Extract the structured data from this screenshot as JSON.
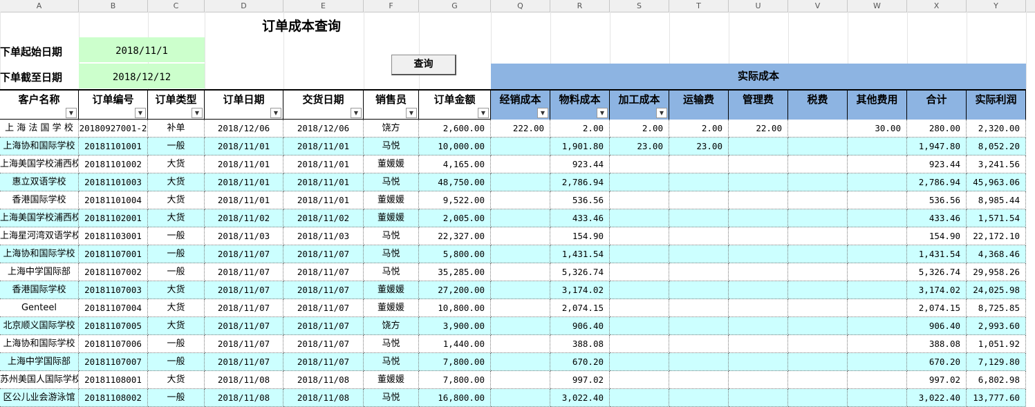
{
  "column_letters": [
    "A",
    "B",
    "C",
    "D",
    "E",
    "F",
    "G",
    "Q",
    "R",
    "S",
    "T",
    "U",
    "V",
    "W",
    "X",
    "Y"
  ],
  "title": "订单成本查询",
  "start_label": "下单起始日期",
  "start_value": "2018/11/1",
  "end_label": "下单截至日期",
  "end_value": "2018/12/12",
  "query_button": "查询",
  "band_label": "实际成本",
  "headers": [
    "客户名称",
    "订单编号",
    "订单类型",
    "订单日期",
    "交货日期",
    "销售员",
    "订单金额",
    "经销成本",
    "物料成本",
    "加工成本",
    "运输费",
    "管理费",
    "税费",
    "其他费用",
    "合计",
    "实际利润"
  ],
  "rows": [
    [
      "上 海 法 国 学 校",
      "20180927001-2",
      "补单",
      "2018/12/06",
      "2018/12/06",
      "饶方",
      "2,600.00",
      "222.00",
      "2.00",
      "2.00",
      "2.00",
      "22.00",
      "",
      "30.00",
      "280.00",
      "2,320.00"
    ],
    [
      "上海协和国际学校",
      "20181101001",
      "一般",
      "2018/11/01",
      "2018/11/01",
      "马悦",
      "10,000.00",
      "",
      "1,901.80",
      "23.00",
      "23.00",
      "",
      "",
      "",
      "1,947.80",
      "8,052.20"
    ],
    [
      "上海美国学校浦西校",
      "20181101002",
      "大货",
      "2018/11/01",
      "2018/11/01",
      "董媛媛",
      "4,165.00",
      "",
      "923.44",
      "",
      "",
      "",
      "",
      "",
      "923.44",
      "3,241.56"
    ],
    [
      "惠立双语学校",
      "20181101003",
      "大货",
      "2018/11/01",
      "2018/11/01",
      "马悦",
      "48,750.00",
      "",
      "2,786.94",
      "",
      "",
      "",
      "",
      "",
      "2,786.94",
      "45,963.06"
    ],
    [
      "香港国际学校",
      "20181101004",
      "大货",
      "2018/11/01",
      "2018/11/01",
      "董媛媛",
      "9,522.00",
      "",
      "536.56",
      "",
      "",
      "",
      "",
      "",
      "536.56",
      "8,985.44"
    ],
    [
      "上海美国学校浦西校",
      "20181102001",
      "大货",
      "2018/11/02",
      "2018/11/02",
      "董媛媛",
      "2,005.00",
      "",
      "433.46",
      "",
      "",
      "",
      "",
      "",
      "433.46",
      "1,571.54"
    ],
    [
      "上海星河湾双语学校",
      "20181103001",
      "一般",
      "2018/11/03",
      "2018/11/03",
      "马悦",
      "22,327.00",
      "",
      "154.90",
      "",
      "",
      "",
      "",
      "",
      "154.90",
      "22,172.10"
    ],
    [
      "上海协和国际学校",
      "20181107001",
      "一般",
      "2018/11/07",
      "2018/11/07",
      "马悦",
      "5,800.00",
      "",
      "1,431.54",
      "",
      "",
      "",
      "",
      "",
      "1,431.54",
      "4,368.46"
    ],
    [
      "上海中学国际部",
      "20181107002",
      "一般",
      "2018/11/07",
      "2018/11/07",
      "马悦",
      "35,285.00",
      "",
      "5,326.74",
      "",
      "",
      "",
      "",
      "",
      "5,326.74",
      "29,958.26"
    ],
    [
      "香港国际学校",
      "20181107003",
      "大货",
      "2018/11/07",
      "2018/11/07",
      "董媛媛",
      "27,200.00",
      "",
      "3,174.02",
      "",
      "",
      "",
      "",
      "",
      "3,174.02",
      "24,025.98"
    ],
    [
      "Genteel",
      "20181107004",
      "大货",
      "2018/11/07",
      "2018/11/07",
      "董媛媛",
      "10,800.00",
      "",
      "2,074.15",
      "",
      "",
      "",
      "",
      "",
      "2,074.15",
      "8,725.85"
    ],
    [
      "北京顺义国际学校",
      "20181107005",
      "大货",
      "2018/11/07",
      "2018/11/07",
      "饶方",
      "3,900.00",
      "",
      "906.40",
      "",
      "",
      "",
      "",
      "",
      "906.40",
      "2,993.60"
    ],
    [
      "上海协和国际学校",
      "20181107006",
      "一般",
      "2018/11/07",
      "2018/11/07",
      "马悦",
      "1,440.00",
      "",
      "388.08",
      "",
      "",
      "",
      "",
      "",
      "388.08",
      "1,051.92"
    ],
    [
      "上海中学国际部",
      "20181107007",
      "一般",
      "2018/11/07",
      "2018/11/07",
      "马悦",
      "7,800.00",
      "",
      "670.20",
      "",
      "",
      "",
      "",
      "",
      "670.20",
      "7,129.80"
    ],
    [
      "苏州美国人国际学校",
      "20181108001",
      "大货",
      "2018/11/08",
      "2018/11/08",
      "董媛媛",
      "7,800.00",
      "",
      "997.02",
      "",
      "",
      "",
      "",
      "",
      "997.02",
      "6,802.98"
    ],
    [
      "区公儿业会游泳馆",
      "20181108002",
      "一般",
      "2018/11/08",
      "2018/11/08",
      "马悦",
      "16,800.00",
      "",
      "3,022.40",
      "",
      "",
      "",
      "",
      "",
      "3,022.40",
      "13,777.60"
    ]
  ]
}
